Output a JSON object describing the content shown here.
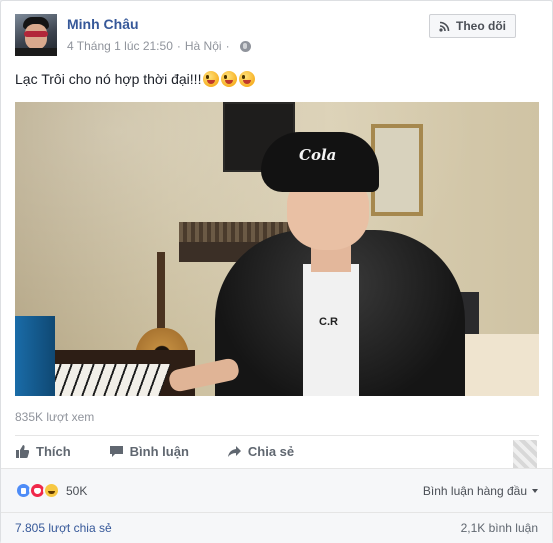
{
  "post": {
    "author": "Minh Châu",
    "timestamp": "4 Tháng 1 lúc 21:50",
    "separator": "·",
    "location": "Hà Nội",
    "audience_icon": "globe-icon",
    "follow_label": "Theo dõi",
    "text": "Lạc Trôi cho nó hợp thời đại!!!",
    "emojis": [
      "winking-tongue-emoji",
      "winking-tongue-emoji",
      "winking-tongue-emoji"
    ]
  },
  "video": {
    "cap_text": "Cola",
    "shirt_text": "C.R"
  },
  "stats": {
    "views": "835K lượt xem"
  },
  "actions": {
    "like": "Thích",
    "comment": "Bình luận",
    "share": "Chia sẻ"
  },
  "reactions": {
    "types": [
      "like",
      "love",
      "haha"
    ],
    "count": "50K",
    "sort_label": "Bình luận hàng đầu"
  },
  "footer": {
    "shares": "7.805 lượt chia sẻ",
    "comments": "2,1K bình luận"
  },
  "colors": {
    "link": "#365899",
    "muted": "#90949c",
    "like_blue": "#4e8cf7",
    "love_red": "#f0284a",
    "haha_yellow": "#f7c843"
  }
}
